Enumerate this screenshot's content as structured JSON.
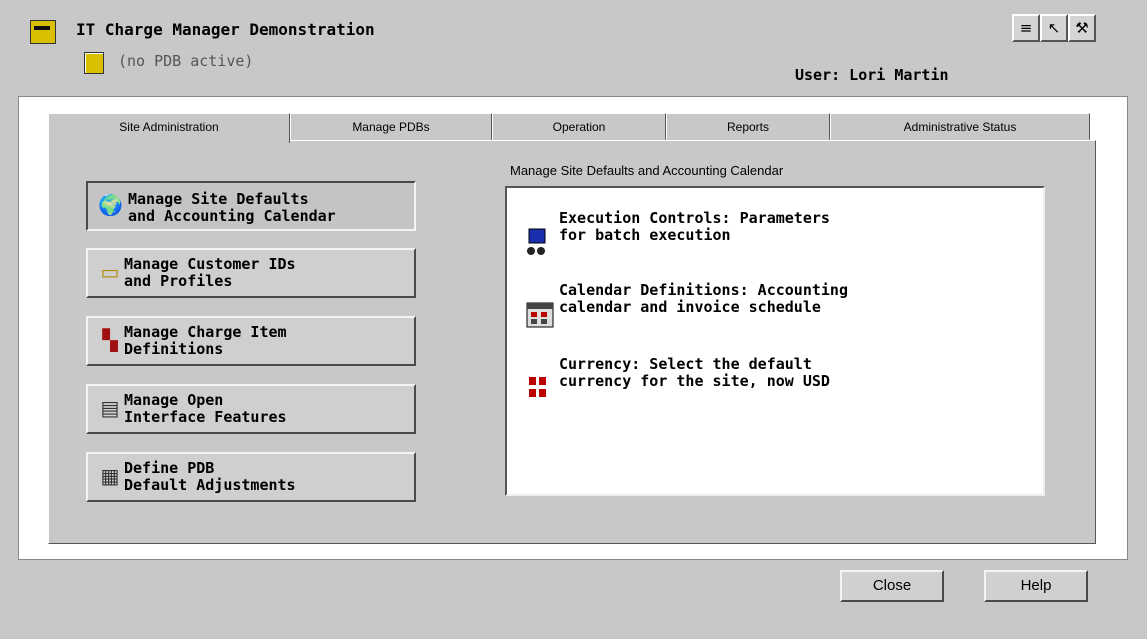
{
  "header": {
    "app_title": "IT Charge Manager Demonstration",
    "pdb_status": "(no PDB active)",
    "user_label": "User: Lori Martin",
    "toolbar_icons": [
      "traffic-light-icon",
      "pointer-help-icon",
      "wand-icon"
    ]
  },
  "tabs": [
    {
      "label": "Site Administration",
      "active": true
    },
    {
      "label": "Manage PDBs",
      "active": false
    },
    {
      "label": "Operation",
      "active": false
    },
    {
      "label": "Reports",
      "active": false
    },
    {
      "label": "Administrative Status",
      "active": false
    }
  ],
  "nav": [
    {
      "label": "Manage Site Defaults\nand Accounting Calendar",
      "icon": "globe-icon",
      "selected": true
    },
    {
      "label": "Manage Customer IDs\nand Profiles",
      "icon": "id-card-icon",
      "selected": false
    },
    {
      "label": "Manage Charge Item\nDefinitions",
      "icon": "charge-items-icon",
      "selected": false
    },
    {
      "label": "Manage Open\nInterface Features",
      "icon": "interface-icon",
      "selected": false
    },
    {
      "label": "Define PDB\nDefault Adjustments",
      "icon": "adjustments-icon",
      "selected": false
    }
  ],
  "panel": {
    "heading": "Manage Site Defaults and Accounting Calendar",
    "options": [
      {
        "text": "Execution Controls: Parameters\nfor batch execution",
        "icon": "computer-icon"
      },
      {
        "text": "Calendar Definitions: Accounting\ncalendar and invoice schedule",
        "icon": "calendar-icon"
      },
      {
        "text": "Currency: Select the default\ncurrency for the site, now USD",
        "icon": "currency-icon"
      }
    ]
  },
  "buttons": {
    "close": "Close",
    "help": "Help"
  }
}
